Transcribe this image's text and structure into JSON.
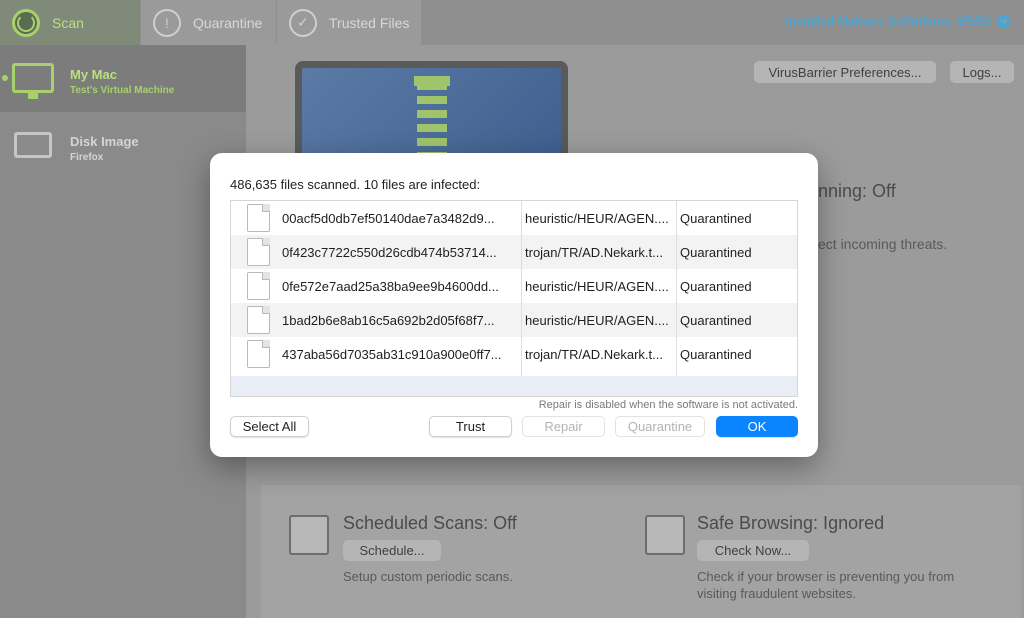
{
  "tabs": [
    {
      "label": "Scan",
      "icon": "scan-icon"
    },
    {
      "label": "Quarantine",
      "icon": "warning-icon"
    },
    {
      "label": "Trusted Files",
      "icon": "checkmark-icon"
    }
  ],
  "definitions": {
    "label": "Installed Malware Definitions: 6/5/25"
  },
  "sidebar": {
    "items": [
      {
        "title": "My Mac",
        "subtitle": "Test's Virtual Machine",
        "icon": "monitor-icon"
      },
      {
        "title": "Disk Image",
        "subtitle": "Firefox",
        "icon": "disk-icon"
      }
    ]
  },
  "main": {
    "preferences_label": "VirusBarrier Preferences...",
    "logs_label": "Logs...",
    "realtime_title_partial": "nning: Off",
    "realtime_desc_partial": "ect incoming threats.",
    "scheduled": {
      "title": "Scheduled Scans: Off",
      "button": "Schedule...",
      "desc": "Setup custom periodic scans."
    },
    "browsing": {
      "title": "Safe Browsing: Ignored",
      "button": "Check Now...",
      "desc_line1": "Check if your browser is preventing you from",
      "desc_line2": "visiting fraudulent websites."
    }
  },
  "dialog": {
    "summary": "486,635 files scanned. 10 files are infected:",
    "rows": [
      {
        "name": "00acf5d0db7ef50140dae7a3482d9...",
        "threat": "heuristic/HEUR/AGEN....",
        "status": "Quarantined"
      },
      {
        "name": "0f423c7722c550d26cdb474b53714...",
        "threat": "trojan/TR/AD.Nekark.t...",
        "status": "Quarantined"
      },
      {
        "name": "0fe572e7aad25a38ba9ee9b4600dd...",
        "threat": "heuristic/HEUR/AGEN....",
        "status": "Quarantined"
      },
      {
        "name": "1bad2b6e8ab16c5a692b2d05f68f7...",
        "threat": "heuristic/HEUR/AGEN....",
        "status": "Quarantined"
      },
      {
        "name": "437aba56d7035ab31c910a900e0ff7...",
        "threat": "trojan/TR/AD.Nekark.t...",
        "status": "Quarantined"
      }
    ],
    "note": "Repair is disabled when the software is not activated.",
    "buttons": {
      "select_all": "Select All",
      "trust": "Trust",
      "repair": "Repair",
      "quarantine": "Quarantine",
      "ok": "OK"
    }
  },
  "colors": {
    "accent_green": "#a7d26b",
    "definitions_blue": "#4aa6d6",
    "ok_blue": "#0a84ff"
  }
}
